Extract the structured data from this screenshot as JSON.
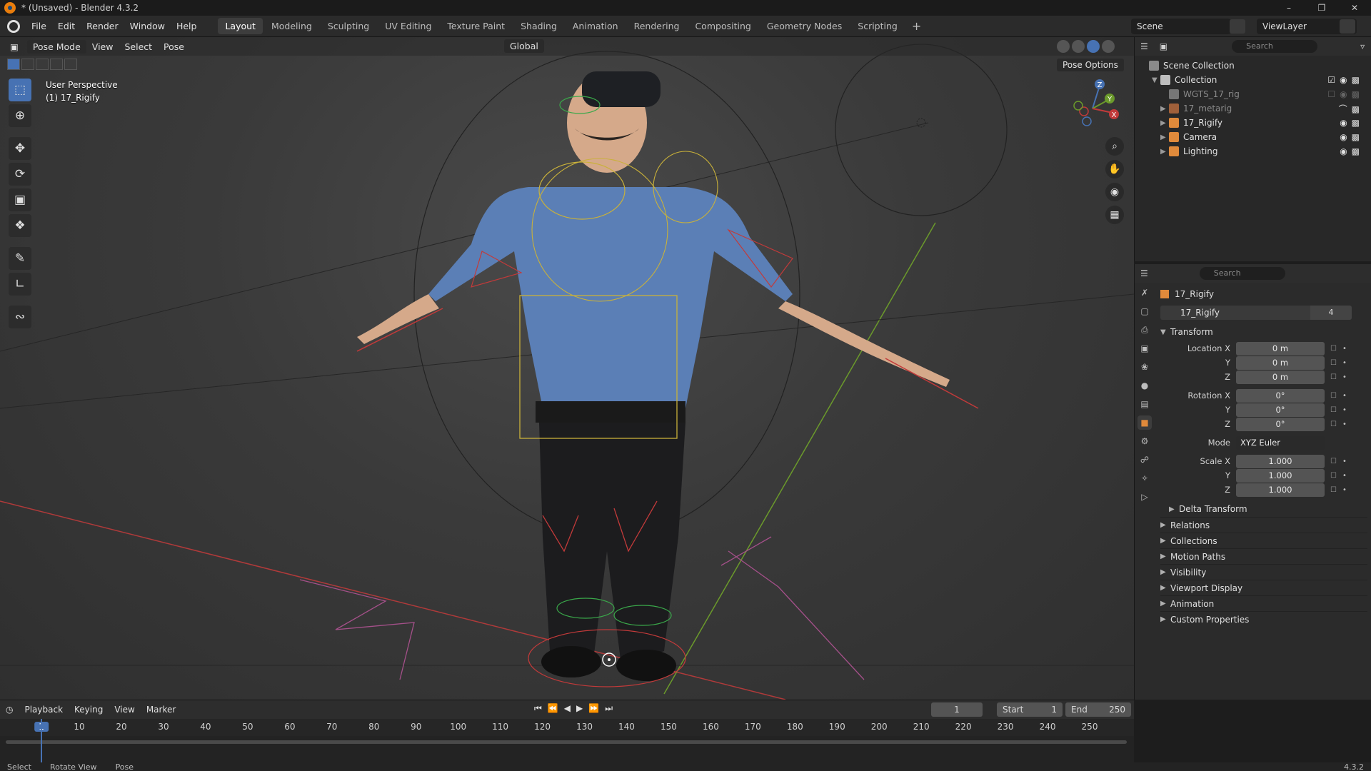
{
  "titlebar": {
    "title": "* (Unsaved) - Blender 4.3.2",
    "minimize": "–",
    "maximize": "❐",
    "close": "✕"
  },
  "menu": [
    "File",
    "Edit",
    "Render",
    "Window",
    "Help"
  ],
  "workspaces": [
    "Layout",
    "Modeling",
    "Sculpting",
    "UV Editing",
    "Texture Paint",
    "Shading",
    "Animation",
    "Rendering",
    "Compositing",
    "Geometry Nodes",
    "Scripting"
  ],
  "workspace_active": "Layout",
  "workspace_add": "+",
  "scene": "Scene",
  "view_layer": "ViewLayer",
  "viewport": {
    "mode": "Pose Mode",
    "menus": [
      "View",
      "Select",
      "Pose"
    ],
    "transform_orientation": "Global",
    "pose_options": "Pose Options",
    "info_line1": "User Perspective",
    "info_line2": "(1) 17_Rigify",
    "gizmo": {
      "z": "Z",
      "y": "Y",
      "x": "X"
    }
  },
  "toolbar_icons": [
    "select-box-icon",
    "cursor-icon",
    "move-icon",
    "rotate-icon",
    "scale-icon",
    "transform-icon",
    "annotate-icon",
    "measure-icon",
    "relax-icon"
  ],
  "outliner": {
    "search_placeholder": "Search",
    "rows": [
      {
        "label": "Scene Collection",
        "depth": 0,
        "icon": "scene-collection-icon",
        "dim": false
      },
      {
        "label": "Collection",
        "depth": 1,
        "icon": "collection-icon",
        "dim": false
      },
      {
        "label": "WGTS_17_rig",
        "depth": 2,
        "icon": "collection-icon",
        "dim": true
      },
      {
        "label": "17_metarig",
        "depth": 2,
        "icon": "armature-icon",
        "dim": true
      },
      {
        "label": "17_Rigify",
        "depth": 2,
        "icon": "armature-icon",
        "dim": false
      },
      {
        "label": "Camera",
        "depth": 2,
        "icon": "camera-icon",
        "dim": false
      },
      {
        "label": "Lighting",
        "depth": 2,
        "icon": "light-icon",
        "dim": false
      }
    ]
  },
  "properties": {
    "search_placeholder": "Search",
    "object_name": "17_Rigify",
    "object_field": "17_Rigify",
    "users": "4",
    "transform_label": "Transform",
    "location": {
      "x_label": "Location X",
      "y_label": "Y",
      "z_label": "Z",
      "x": "0 m",
      "y": "0 m",
      "z": "0 m"
    },
    "rotation": {
      "x_label": "Rotation X",
      "y_label": "Y",
      "z_label": "Z",
      "x": "0°",
      "y": "0°",
      "z": "0°"
    },
    "mode_label": "Mode",
    "mode_value": "XYZ Euler",
    "scale": {
      "x_label": "Scale X",
      "y_label": "Y",
      "z_label": "Z",
      "x": "1.000",
      "y": "1.000",
      "z": "1.000"
    },
    "delta_transform": "Delta Transform",
    "panels": [
      "Relations",
      "Collections",
      "Motion Paths",
      "Visibility",
      "Viewport Display",
      "Animation",
      "Custom Properties"
    ]
  },
  "timeline": {
    "menus": [
      "Playback",
      "Keying",
      "View",
      "Marker"
    ],
    "current_frame": "1",
    "start_label": "Start",
    "start_value": "1",
    "end_label": "End",
    "end_value": "250",
    "ticks": [
      "1",
      "10",
      "20",
      "30",
      "40",
      "50",
      "60",
      "70",
      "80",
      "90",
      "100",
      "110",
      "120",
      "130",
      "140",
      "150",
      "160",
      "170",
      "180",
      "190",
      "200",
      "210",
      "220",
      "230",
      "240",
      "250"
    ]
  },
  "status": {
    "select": "Select",
    "rotate": "Rotate View",
    "pose": "Pose",
    "version": "4.3.2"
  },
  "colors": {
    "accent": "#4772b3",
    "orange": "#e87d0d",
    "bg": "#1d1d1d"
  }
}
